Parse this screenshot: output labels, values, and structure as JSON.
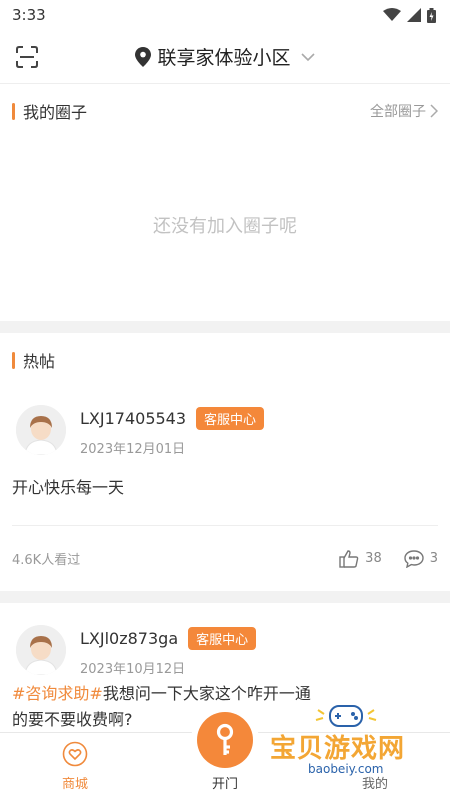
{
  "status_bar": {
    "time": "3:33"
  },
  "header": {
    "location": "联享家体验小区"
  },
  "my_circles": {
    "title": "我的圈子",
    "all_link": "全部圈子",
    "empty_text": "还没有加入圈子呢"
  },
  "hot_posts": {
    "title": "热帖",
    "posts": [
      {
        "author": "LXJ17405543",
        "badge": "客服中心",
        "date": "2023年12月01日",
        "content_tag": "",
        "content": "开心快乐每一天",
        "views": "4.6K人看过",
        "likes": "38",
        "comments": "3"
      },
      {
        "author": "LXJl0z873ga",
        "badge": "客服中心",
        "date": "2023年10月12日",
        "content_tag": "#咨询求助#",
        "content": "我想问一下大家这个咋开一通的要不要收费啊?"
      }
    ]
  },
  "bottom_nav": {
    "mall_label": "商城",
    "open_door_label": "开门",
    "mine_label": "我的"
  },
  "watermark": {
    "title": "宝贝游戏网",
    "url": "baobeiy.com"
  },
  "colors": {
    "accent": "#f08a3c",
    "badge": "#f4883a"
  }
}
